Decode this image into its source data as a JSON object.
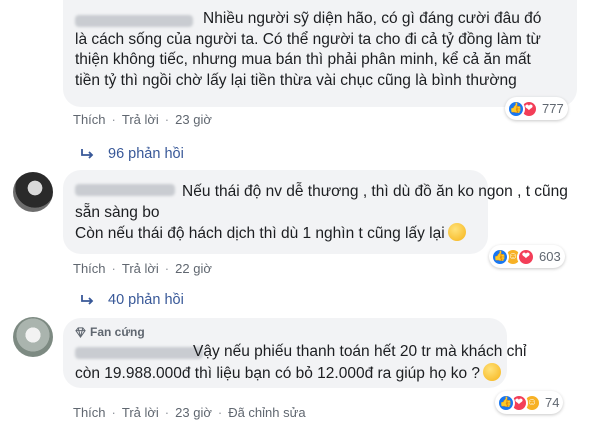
{
  "comments": [
    {
      "lines": [
        "Nhiều người sỹ diện hão, có gì đáng cười đâu đó",
        "là cách sống của người ta. Có thể người ta cho đi cả tỷ đồng làm từ",
        "thiện không tiếc, nhưng mua bán thì phải phân minh, kể cả ăn mất",
        "tiền tỷ thì ngồi chờ lấy lại tiền thừa vài chục cũng là bình thường"
      ],
      "actions": {
        "like": "Thích",
        "reply": "Trả lời",
        "time": "23 giờ"
      },
      "reaction_count": "777",
      "replies": "96 phản hồi"
    },
    {
      "lines": [
        "Nếu thái độ nv dễ thương , thì dù đồ ăn ko ngon , t cũng",
        "sẵn sàng bo",
        "Còn nếu thái độ hách dịch thì dù 1 nghìn t cũng lấy lại"
      ],
      "actions": {
        "like": "Thích",
        "reply": "Trả lời",
        "time": "22 giờ"
      },
      "reaction_count": "603",
      "replies": "40 phản hồi"
    },
    {
      "badge": "Fan cứng",
      "lines": [
        "Vậy nếu phiếu thanh toán hết 20 tr mà khách chỉ",
        "còn 19.988.000đ thì liệu bạn có bỏ 12.000đ ra giúp họ ko ?"
      ],
      "actions": {
        "like": "Thích",
        "reply": "Trả lời",
        "time": "23 giờ",
        "edited": "Đã chỉnh sửa"
      },
      "reaction_count": "74"
    }
  ],
  "colors": {
    "bubble": "#f2f3f5",
    "link": "#385898",
    "meta": "#606770",
    "like": "#1877f2",
    "love": "#f33e58",
    "haha": "#f7b125"
  },
  "icons": {
    "reply_arrow": "reply-arrow-icon",
    "badge": "diamond-icon",
    "emoji": "smile-emoji-icon"
  }
}
